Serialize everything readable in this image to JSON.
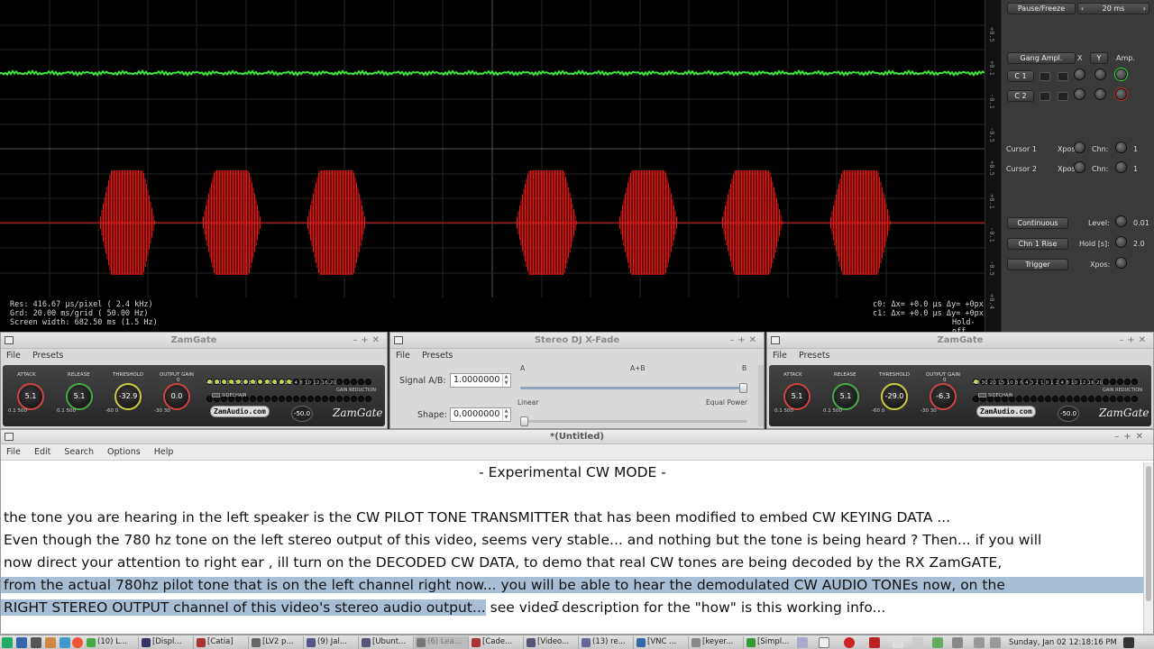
{
  "scope": {
    "status_left": [
      "Res: 416.67 µs/pixel (  2.4 kHz)",
      "Grd:  20.00 ms/grid  ( 50.00 Hz)",
      "Screen width: 682.50 ms (1.5 Hz)"
    ],
    "status_right": [
      "c0: Δx=  +0.0 µs Δy=  +0px",
      "c1: Δx=  +0.0 µs Δy=  +0px"
    ],
    "holdoff": "Hold-off",
    "rail_ticks": [
      "+0.5",
      "+0.1",
      "-0.1",
      "-0.5",
      "+0.5",
      "+0.1",
      "-0.1",
      "-0.5",
      "+0.4"
    ]
  },
  "controls": {
    "pause": "Pause/Freeze",
    "timebase": "20 ms",
    "gang": "Gang Ampl.",
    "x": "X",
    "y": "Y",
    "amp": "Amp.",
    "c1": "C 1",
    "c2": "C 2",
    "cursor1": "Cursor 1",
    "cursor2": "Cursor 2",
    "xpos": "Xpos:",
    "chn": "Chn:",
    "chn_val": "1",
    "continuous": "Continuous",
    "level": "Level:",
    "level_val": "0.01",
    "rise": "Chn 1 Rise",
    "hold": "Hold [s]:",
    "hold_val": "2.0",
    "trigger": "Trigger"
  },
  "zam1": {
    "title": "ZamGate",
    "menu": [
      "File",
      "Presets"
    ],
    "labels": [
      "Attack",
      "Release",
      "Threshold",
      "Output Gain"
    ],
    "values": [
      "5.1",
      "5.1",
      "-32.9",
      "0.0"
    ],
    "ranges": [
      "0.1   500",
      "0.1   500",
      "-60   0",
      "-30   30"
    ],
    "meter_top": "0",
    "meter_nums": "40 30 20 15 10  8  6  4  3  2  1  0  1  2  4  8 10 12 16 20",
    "gain_reduction": "GAIN REDUCTION",
    "sidechain": "SIDECHAIN",
    "logo": "ZamAudio.com",
    "brand": "ZamGate",
    "small_knob": "-50.0",
    "leds_on": 12
  },
  "xfade": {
    "title": "Stereo DJ X-Fade",
    "menu": [
      "File",
      "Presets"
    ],
    "signal_label": "Signal A/B:",
    "signal_value": "1.0000000",
    "shape_label": "Shape:",
    "shape_value": "0.0000000",
    "a": "A",
    "ab": "A+B",
    "b": "B",
    "linear": "Linear",
    "equal_power": "Equal Power",
    "signal_pos": 1.0,
    "shape_pos": 0.0
  },
  "zam2": {
    "title": "ZamGate",
    "menu": [
      "File",
      "Presets"
    ],
    "labels": [
      "Attack",
      "Release",
      "Threshold",
      "Output Gain"
    ],
    "values": [
      "5.1",
      "5.1",
      "-29.0",
      "-6.3"
    ],
    "ranges": [
      "0.1   500",
      "0.1   500",
      "-60   0",
      "-30   30"
    ],
    "meter_top": "0",
    "meter_nums": "40 30 20 15 10  8  6  4  3  2  1  0  1  2  4  8 10 12 16 20",
    "gain_reduction": "GAIN REDUCTION",
    "sidechain": "SIDECHAIN",
    "logo": "ZamAudio.com",
    "brand": "ZamGate",
    "small_knob": "-50.0",
    "leds_on": 1
  },
  "editor": {
    "title": "*(Untitled)",
    "menu": [
      "File",
      "Edit",
      "Search",
      "Options",
      "Help"
    ],
    "heading": "- Experimental CW MODE -",
    "lines": [
      "    the tone you are hearing in the left speaker is the CW PILOT TONE TRANSMITTER that has been modified to embed CW KEYING DATA  ...",
      "Even though the 780 hz tone on the left stereo output of this video,  seems very stable... and nothing  but the tone is being heard ?    Then... if you will",
      "now direct your attention to right ear , ill turn on the DECODED CW DATA,  to demo that real CW tones are being decoded by the RX ZamGATE,",
      "from the actual 780hz pilot tone that is on the left channel right now... you will be able to hear the demodulated CW AUDIO TONEs now,  on the",
      "RIGHT STEREO OUTPUT channel of this video's stereo audio output..."
    ],
    "tail": "         see video description for   the  \"how\" is this working info..."
  },
  "taskbar": {
    "tasks": [
      "(10) L...",
      "[Displ...",
      "[Catia]",
      "[LV2 p...",
      "(9) Jal...",
      "[Ubunt...",
      "(6) Lea...",
      "[Cade...",
      "[Video...",
      "(13) re...",
      "[VNC ...",
      "[keyer...",
      "[Simpl..."
    ],
    "clock": "Sunday, Jan 02 12:18:16 PM"
  },
  "colors": {
    "trace_green": "#3ce63c",
    "trace_red": "#e01818",
    "selection": "#a7bfd6"
  }
}
